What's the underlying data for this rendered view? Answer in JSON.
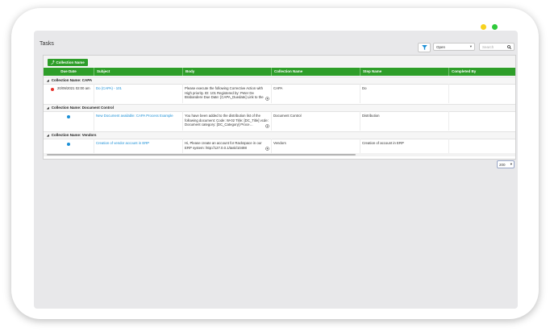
{
  "window": {
    "dots": {
      "yellow": "#f7d21e",
      "green": "#2fc93b"
    }
  },
  "page": {
    "title": "Tasks",
    "filter_icon": "filter-icon",
    "status_filter": {
      "value": "Open"
    },
    "search": {
      "placeholder": "Search",
      "icon": "search-icon"
    },
    "page_size": "200"
  },
  "grid": {
    "accent": "#2e9e29",
    "grouping_chip": {
      "icon": "pin-icon",
      "label": "Collection Name"
    },
    "columns": {
      "due_date": "Due Date",
      "subject": "Subject",
      "body": "Body",
      "collection": "Collection Name",
      "step": "Step Name",
      "completed_by": "Completed By"
    },
    "groups": [
      {
        "header": "Collection Name: CAPA",
        "row": {
          "status_color": "#e8322b",
          "due_date": "20/09/2021 02:00 am",
          "subject": "Do (CAPA) - 101",
          "body": "Please execute the following Corrective Action with High priority. ID: 101 Registered by:  Peter De Brabandere Due Date: [CAPA_Duedate] Link to the t…",
          "collection": "CAPA",
          "step": "Do"
        }
      },
      {
        "header": "Collection Name: Document Control",
        "row": {
          "status_color": "#1a8fd6",
          "due_date": "",
          "subject": "New Document available: CAPA Process Example",
          "body": "You have been added to the distribution list of the following document: Code: W-02 Title: [DC_Title] vcde: Document category: [DC_Category] Proce…",
          "collection": "Document Control",
          "step": "Distribution"
        }
      },
      {
        "header": "Collection Name: Vendors",
        "row": {
          "status_color": "#1a8fd6",
          "due_date": "",
          "subject": "Creation of vendor account in ERP",
          "body": "Hi, Please create an account for  Rackspace in our ERP system:  http://127.0.0.1/task/10498",
          "collection": "Vendors",
          "step": "Creation of account in ERP"
        }
      }
    ]
  }
}
